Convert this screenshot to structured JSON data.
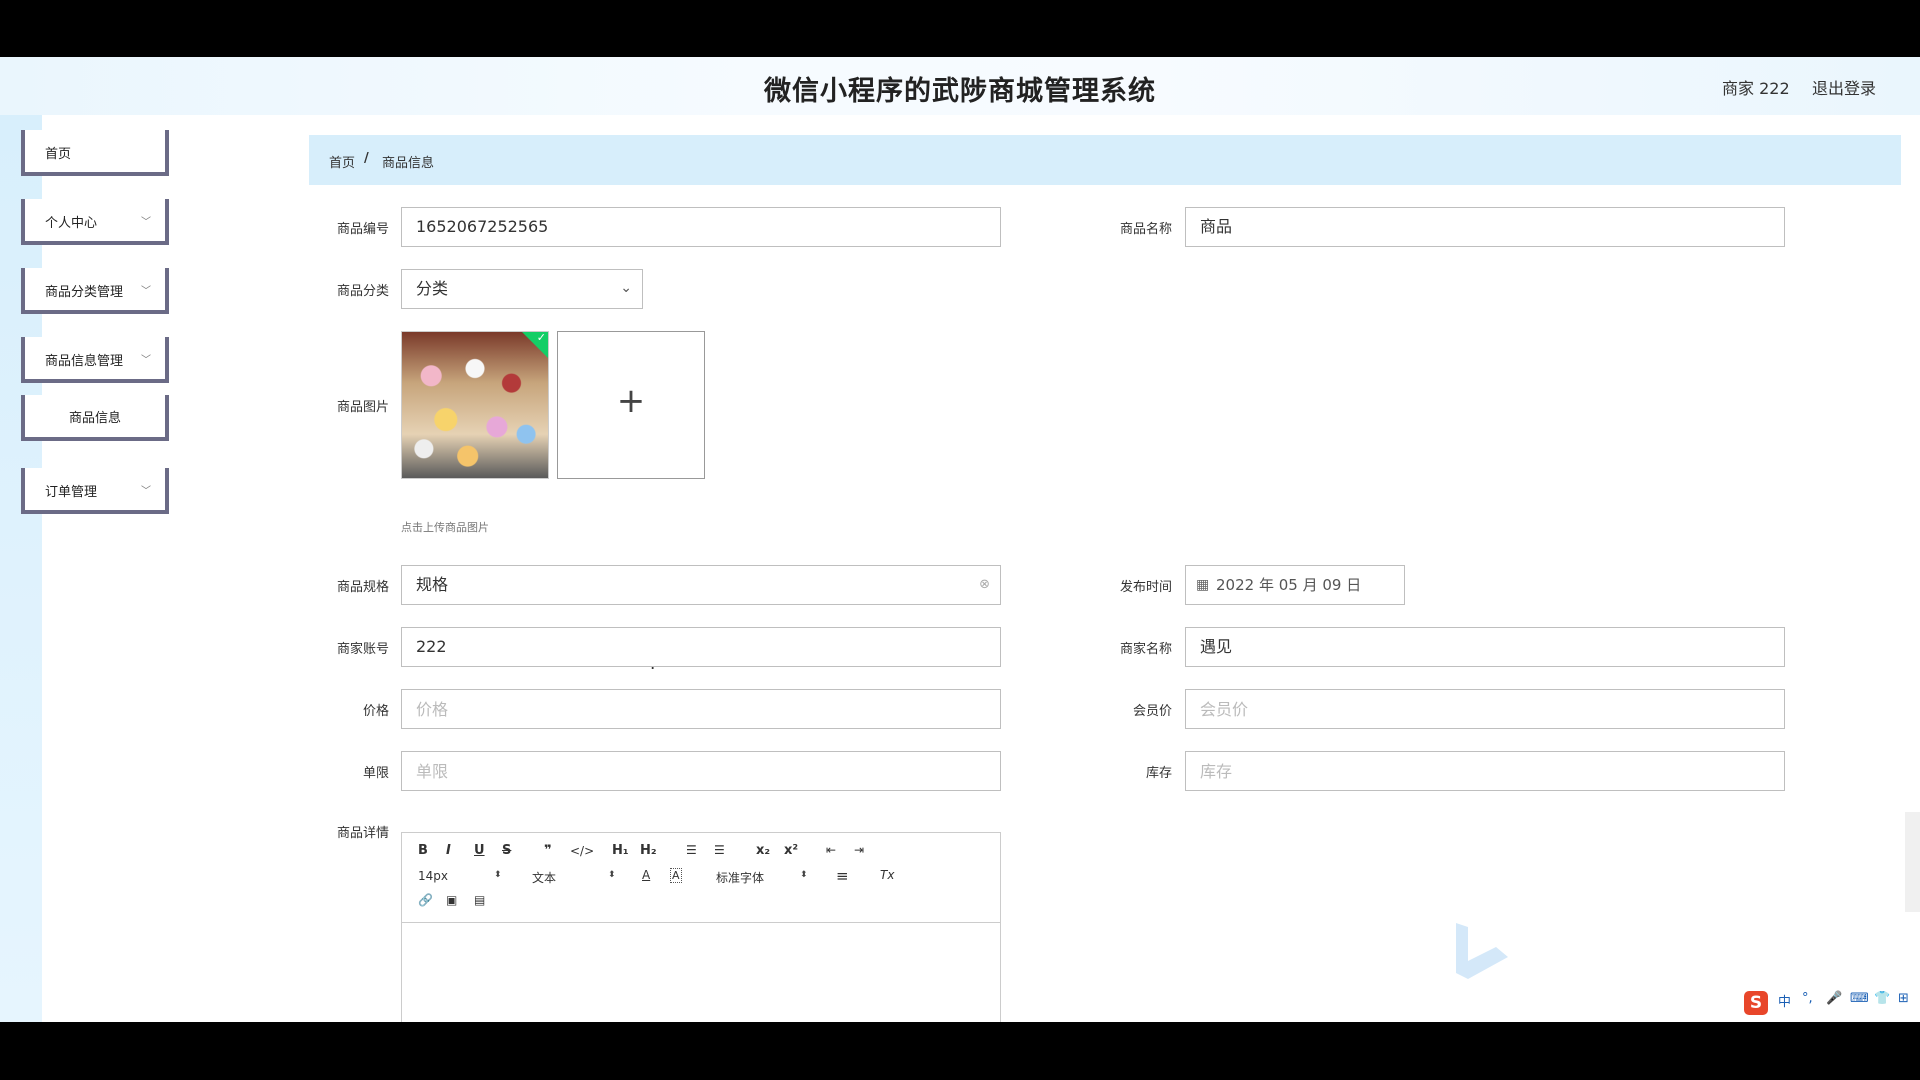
{
  "header": {
    "title": "微信小程序的武陟商城管理系统",
    "user_label": "商家 222",
    "logout_label": "退出登录"
  },
  "sidebar": {
    "items": [
      {
        "label": "首页"
      },
      {
        "label": "个人中心"
      },
      {
        "label": "商品分类管理"
      },
      {
        "label": "商品信息管理"
      },
      {
        "label": "商品信息"
      },
      {
        "label": "订单管理"
      }
    ]
  },
  "breadcrumb": {
    "home": "首页",
    "separator": "/",
    "current": "商品信息"
  },
  "form": {
    "code": {
      "label": "商品编号",
      "value": "1652067252565"
    },
    "name": {
      "label": "商品名称",
      "value": "商品"
    },
    "category": {
      "label": "商品分类",
      "value": "分类"
    },
    "image": {
      "label": "商品图片",
      "tip": "点击上传商品图片",
      "plus": "+"
    },
    "spec": {
      "label": "商品规格",
      "value": "规格"
    },
    "publish_time": {
      "label": "发布时间",
      "value": "2022 年 05 月 09 日"
    },
    "merchant_account": {
      "label": "商家账号",
      "value": "222"
    },
    "merchant_name": {
      "label": "商家名称",
      "value": "遇见"
    },
    "price": {
      "label": "价格",
      "placeholder": "价格"
    },
    "member_price": {
      "label": "会员价",
      "placeholder": "会员价"
    },
    "limit": {
      "label": "单限",
      "placeholder": "单限"
    },
    "stock": {
      "label": "库存",
      "placeholder": "库存"
    },
    "detail": {
      "label": "商品详情"
    }
  },
  "editor": {
    "bold": "B",
    "italic": "I",
    "underline": "U",
    "strike": "S",
    "blockquote": "❞",
    "code": "</>",
    "h1": "H₁",
    "h2": "H₂",
    "ordered_list": "☰",
    "bullet_list": "☰",
    "subscript": "x₂",
    "superscript": "x²",
    "outdent": "⇤",
    "indent": "⇥",
    "font_size": "14px",
    "text_style": "文本",
    "color": "A",
    "background": "A",
    "font_family": "标准字体",
    "align": "≡",
    "clear": "Tx",
    "link": "🔗",
    "image": "▣",
    "video": "▤"
  },
  "ime": {
    "logo": "S",
    "lang": "中",
    "punct": "°,",
    "mic": "🎤",
    "keyboard": "⌨",
    "skin": "👕",
    "grid": "⊞"
  },
  "colors": {
    "accent_bg": "#d7eefb",
    "sidebar_border": "#6b6b86",
    "upload_check": "#13ce66"
  }
}
